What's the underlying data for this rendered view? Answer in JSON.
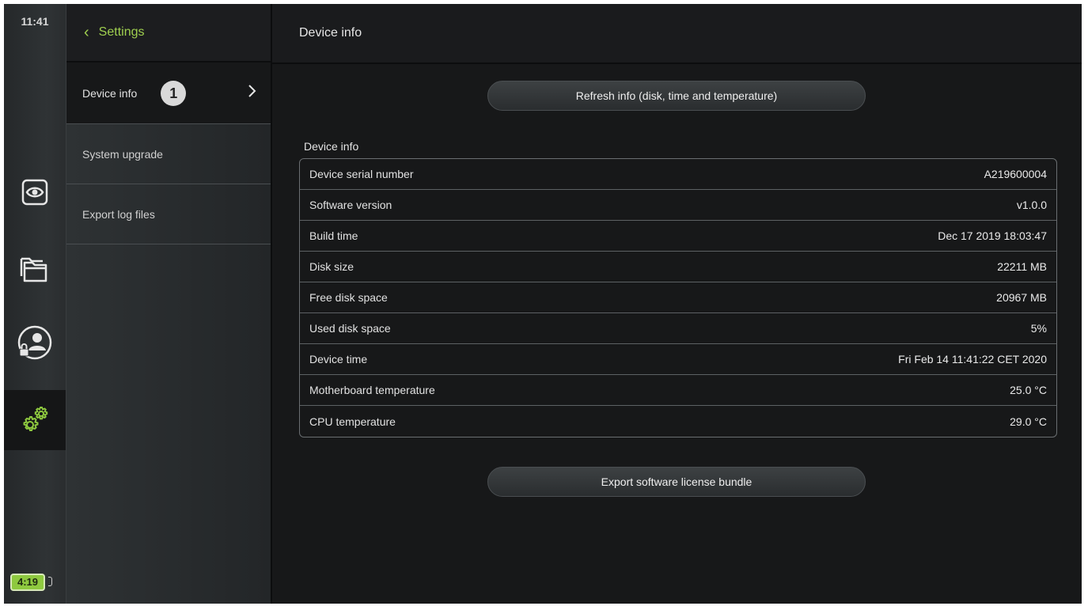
{
  "status": {
    "clock": "11:41",
    "battery": "4:19"
  },
  "rail": {
    "icons": [
      "eye-icon",
      "folders-icon",
      "user-lock-icon",
      "settings-gears-icon"
    ],
    "accent": "#8ec93f"
  },
  "menu": {
    "back_label": "Settings",
    "items": [
      {
        "label": "Device info",
        "callout": "1"
      },
      {
        "label": "System upgrade"
      },
      {
        "label": "Export log files"
      }
    ]
  },
  "main": {
    "title": "Device info",
    "refresh_button": "Refresh info (disk, time and temperature)",
    "section_label": "Device info",
    "rows": [
      {
        "label": "Device serial number",
        "value": "A219600004"
      },
      {
        "label": "Software version",
        "value": "v1.0.0"
      },
      {
        "label": "Build time",
        "value": "Dec 17 2019 18:03:47"
      },
      {
        "label": "Disk size",
        "value": "22211 MB"
      },
      {
        "label": "Free disk space",
        "value": "20967 MB"
      },
      {
        "label": "Used disk space",
        "value": "5%"
      },
      {
        "label": "Device time",
        "value": "Fri Feb 14 11:41:22 CET 2020"
      },
      {
        "label": "Motherboard temperature",
        "value": "25.0 °C"
      },
      {
        "label": "CPU temperature",
        "value": "29.0 °C"
      }
    ],
    "export_button": "Export software license bundle"
  }
}
